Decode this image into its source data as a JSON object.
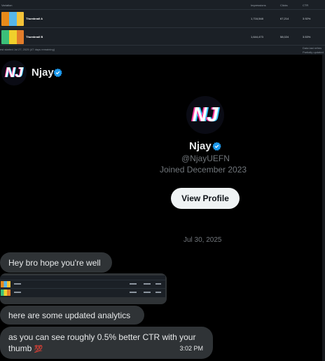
{
  "top_table": {
    "headers": [
      "Variation",
      "Impressions",
      "Clicks",
      "CTR"
    ],
    "rows": [
      {
        "name": "Thumbnail A",
        "impressions": "1,716,548",
        "clicks": "67,214",
        "ctr": "3.92%"
      },
      {
        "name": "Thumbnail B",
        "impressions": "1,644,473",
        "clicks": "58,024",
        "ctr": "3.53%"
      }
    ],
    "footer_left": "est started Jul 27, 2025 (47 days remaining)",
    "footer_right_1": "Data last refres",
    "footer_right_2": "Partially updated"
  },
  "header": {
    "avatar_text": "NJ",
    "name": "Njay"
  },
  "profile": {
    "avatar_text": "NJ",
    "name": "Njay",
    "handle": "@NjayUEFN",
    "joined": "Joined December 2023",
    "view_button": "View Profile"
  },
  "conversation": {
    "date": "Jul 30, 2025",
    "messages": [
      {
        "text": "Hey bro hope you're well"
      },
      {
        "text": "here are some updated analytics"
      },
      {
        "text": "as you can see roughly 0.5% better CTR with your thumb",
        "emoji": "💯",
        "time": "3:02 PM"
      }
    ]
  },
  "colors": {
    "background": "#000000",
    "bubble": "#2f3336",
    "verified": "#1d9bf0",
    "muted": "#71767b",
    "button_bg": "#eff3f4"
  }
}
